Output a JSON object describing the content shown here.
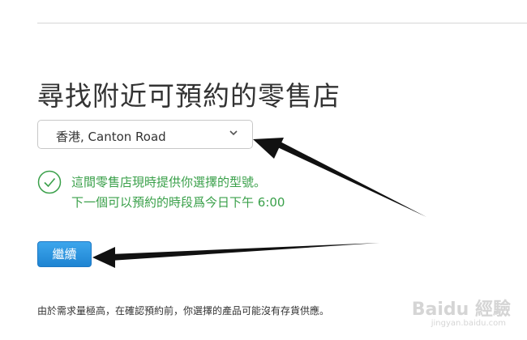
{
  "page": {
    "title": "尋找附近可預約的零售店"
  },
  "store_select": {
    "value": "香港, Canton Road",
    "icon": "chevron-down-icon"
  },
  "availability": {
    "icon": "check-circle-icon",
    "line1": "這間零售店現時提供你選擇的型號。",
    "line2": "下一個可以預約的時段爲今日下午 6:00",
    "color": "#3aa04a"
  },
  "continue_button": {
    "label": "繼續",
    "color": "#1e84d2"
  },
  "disclaimer": {
    "text": "由於需求量極高，在確認預約前，你選擇的產品可能沒有存貨供應。"
  },
  "watermark": {
    "text": "Baidu 經驗",
    "sub": "jingyan.baidu.com"
  }
}
